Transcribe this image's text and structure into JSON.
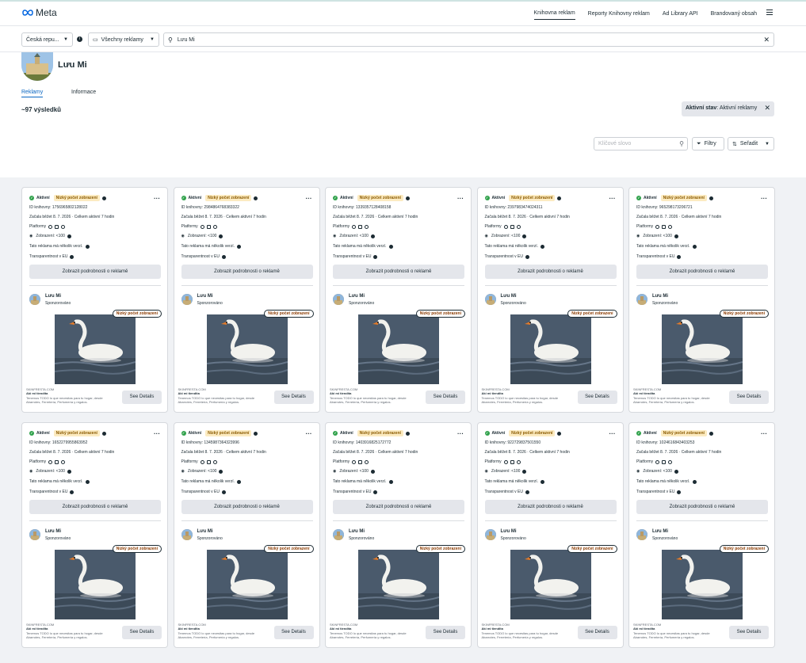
{
  "header": {
    "brand": "Meta",
    "nav": [
      {
        "label": "Knihovna reklam",
        "active": true
      },
      {
        "label": "Reporty Knihovny reklam",
        "active": false
      },
      {
        "label": "Ad Library API",
        "active": false
      },
      {
        "label": "Brandovaný obsah",
        "active": false
      }
    ]
  },
  "search": {
    "country": "Česká repu...",
    "ad_type": "Všechny reklamy",
    "query": "Lưu Mi"
  },
  "profile": {
    "name": "Lưu Mi",
    "tabs": [
      {
        "label": "Reklamy",
        "active": true
      },
      {
        "label": "Informace",
        "active": false
      }
    ],
    "results": "~97 výsledků"
  },
  "toolbar": {
    "keyword_placeholder": "Klíčové slovo",
    "filters": "Filtry",
    "sort": "Seřadit",
    "active_filter_label": "Aktivní stav",
    "active_filter_value": "Aktivní reklamy"
  },
  "card_text": {
    "status": "Aktivní",
    "low_impressions": "Nízký počet zobrazení",
    "id_prefix": "ID knihovny:",
    "started": "Začala běžet 8. 7. 2026 · Celkem aktivní 7 hodin",
    "platforms": "Platformy",
    "impressions": "Zobrazení: <100",
    "versions": "Tato reklama má několik verzí.",
    "eu": "Transparentnost v EU",
    "details": "Zobrazit podrobnosti o reklamě",
    "advertiser": "Lưu Mi",
    "sponsored": "Sponzorováno",
    "domain": "SKINFRESTA.COM",
    "title": "Aki mi tiendita",
    "desc": "Tenemos TODO lo que necesitas para tu hogar, desde Abarrotes, Ferretería, Perfumería y regalos.",
    "see_details": "See Details"
  },
  "cards": [
    {
      "id": "1756965802128022"
    },
    {
      "id": "2984864768383322"
    },
    {
      "id": "1339357128408158"
    },
    {
      "id": "2397983474024311"
    },
    {
      "id": "965298173206721"
    },
    {
      "id": "1652279955863952"
    },
    {
      "id": "1345987364323996"
    },
    {
      "id": "1403916825172772"
    },
    {
      "id": "922729837501550"
    },
    {
      "id": "1024616843403253"
    }
  ],
  "colors": {
    "active_green": "#31a24c",
    "link_blue": "#0a66c2",
    "low_badge": "#fcebc1"
  }
}
